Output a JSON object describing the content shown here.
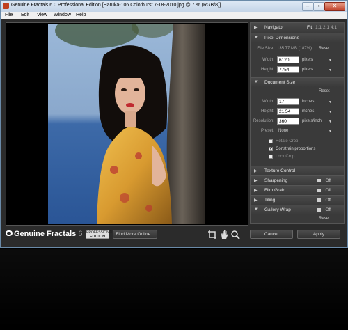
{
  "window": {
    "title": "Genuine Fractals 6.0 Professional Edition [Haruka-106 Colorburst 7-18-2010.jpg @ 7 % (RGB/8)]",
    "controls": [
      "minimize",
      "restore",
      "close"
    ]
  },
  "menu": [
    "File",
    "Edit",
    "View",
    "Window",
    "Help"
  ],
  "panel": {
    "navigator": {
      "label": "Navigator",
      "zoom_options": [
        "Fit",
        "1:1",
        "2:1",
        "4:1"
      ]
    },
    "pixel_dimensions": {
      "label": "Pixel Dimensions",
      "file_size_label": "File Size:",
      "file_size_value": "135.77 MB (187%)",
      "reset": "Reset",
      "width_label": "Width:",
      "width_value": "6120",
      "width_unit": "pixels",
      "height_label": "Height:",
      "height_value": "7754",
      "height_unit": "pixels"
    },
    "document_size": {
      "label": "Document Size",
      "reset": "Reset",
      "width_label": "Width:",
      "width_value": "17",
      "width_unit": "inches",
      "height_label": "Height:",
      "height_value": "21.54",
      "height_unit": "inches",
      "resolution_label": "Resolution:",
      "resolution_value": "360",
      "resolution_unit": "pixels/inch",
      "preset_label": "Preset:",
      "preset_value": "None",
      "rotate_crop": "Rotate Crop",
      "constrain": "Constrain proportions",
      "lock_crop": "Lock Crop"
    },
    "texture_control": "Texture Control",
    "sharpening": {
      "label": "Sharpening",
      "state": "Off"
    },
    "film_grain": {
      "label": "Film Grain",
      "state": "Off"
    },
    "tiling": {
      "label": "Tiling",
      "state": "Off"
    },
    "gallery_wrap": {
      "label": "Gallery Wrap",
      "state": "Off",
      "reset": "Reset"
    }
  },
  "footer": {
    "logo_text": "Genuine Fractals",
    "logo_version": "6",
    "edition_line1": "PROFESSIONAL",
    "edition_line2": "EDITION",
    "find_more": "Find More Online...",
    "cancel": "Cancel",
    "apply": "Apply"
  },
  "tools": [
    "crop-icon",
    "hand-icon",
    "zoom-icon"
  ]
}
